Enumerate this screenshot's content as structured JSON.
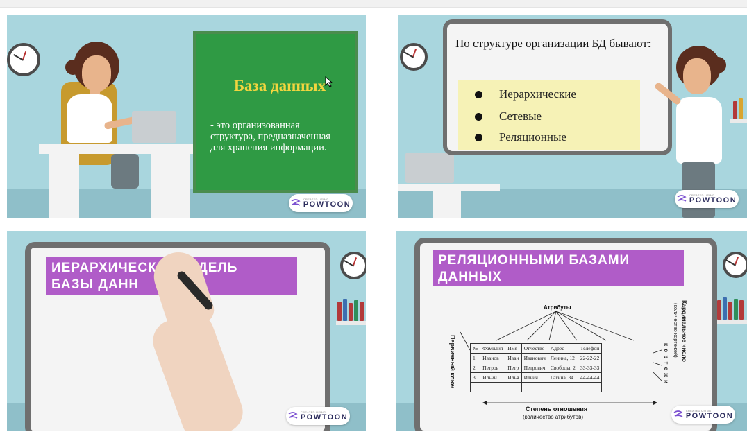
{
  "slide1": {
    "title": "База данных",
    "description": "- это организованная структура, предназначенная для хранения информации.",
    "badge": {
      "small": "CREATED USING",
      "brand": "POWTOON"
    }
  },
  "slide2": {
    "heading": "По структуре организации БД бывают:",
    "items": [
      "Иерархические",
      "Сетевые",
      "Реляционные"
    ],
    "badge": {
      "small": "CREATED USING",
      "brand": "POWTOON"
    }
  },
  "slide3": {
    "banner": "ИЕРАРХИЧЕСКАЯ МОДЕЛЬ БАЗЫ ДАННЫХ",
    "banner_line1_a": "ИЕРАРХИЧЕСК",
    "banner_line1_b": "ОДЕЛЬ",
    "banner_line2": "БАЗЫ ДАНН",
    "badge": {
      "small": "CREATED USING",
      "brand": "POWTOON"
    }
  },
  "slide4": {
    "banner_line1": "РЕЛЯЦИОННЫМИ БАЗАМИ",
    "banner_line2": "ДАННЫХ",
    "attributes_label": "Атрибуты",
    "primary_key_label": "Первичный ключ",
    "tuples_label": "к о р т е ж и",
    "cardinal_label": "Кардинальное число",
    "cardinal_sub": "(количество кортежей)",
    "degree_label": "Степень отношения",
    "degree_sub": "(количество атрибутов)",
    "table": {
      "headers": [
        "№",
        "Фамилия",
        "Имя",
        "Отчество",
        "Адрес",
        "Телефон"
      ],
      "rows": [
        [
          "1",
          "Иванов",
          "Иван",
          "Иванович",
          "Ленина, 12",
          "22-22-22"
        ],
        [
          "2",
          "Петров",
          "Петр",
          "Петрович",
          "Свободы, 2",
          "33-33-33"
        ],
        [
          "3",
          "Ильин",
          "Илья",
          "Ильич",
          "Гагина, 34",
          "44-44-44"
        ],
        [
          "",
          "",
          "",
          "",
          "",
          ""
        ]
      ]
    },
    "badge": {
      "small": "CREATED USING",
      "brand": "POWTOON"
    }
  },
  "colors": {
    "slide_bg": "#a9d6de",
    "green_board": "#2f9a44",
    "title_yellow": "#f2d53f",
    "banner_purple": "#b05cc8",
    "list_box": "#f6f2b6"
  }
}
